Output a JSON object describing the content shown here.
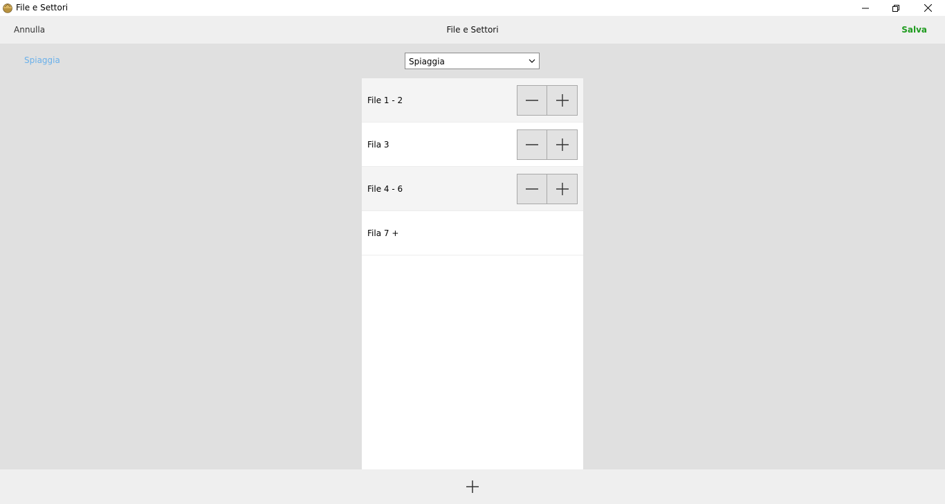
{
  "window": {
    "title": "File e Settori",
    "app_icon": "beach-umbrella-icon"
  },
  "header": {
    "cancel_label": "Annulla",
    "title": "File e Settori",
    "save_label": "Salva",
    "save_color": "#1e9b1e"
  },
  "sidebar": {
    "link_label": "Spiaggia",
    "link_color": "#6ab0ea"
  },
  "selector": {
    "selected": "Spiaggia"
  },
  "rows": [
    {
      "label": "File 1 - 2",
      "has_stepper": true
    },
    {
      "label": "Fila 3",
      "has_stepper": true
    },
    {
      "label": "File 4 - 6",
      "has_stepper": true
    },
    {
      "label": "Fila 7 +",
      "has_stepper": false
    }
  ],
  "icons": {
    "minimize": "minimize-icon",
    "maximize": "restore-icon",
    "close": "close-icon",
    "decrement": "minus-icon",
    "increment": "plus-icon",
    "dropdown": "chevron-down-icon",
    "add": "plus-icon"
  }
}
